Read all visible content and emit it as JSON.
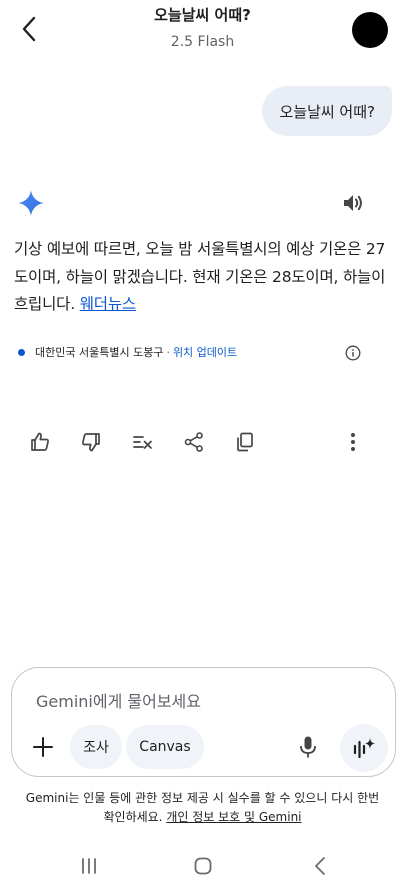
{
  "header": {
    "title": "오늘날씨 어때?",
    "model": "2.5 Flash"
  },
  "conversation": {
    "user_message": "오늘날씨 어때?",
    "answer_text": "기상 예보에 따르면, 오늘 밤 서울특별시의 예상 기온은 27도이며, 하늘이 맑겠습니다. 현재 기온은 28도이며, 하늘이 흐립니다.",
    "source_link": "웨더뉴스",
    "location": "대한민국 서울특별시 도봉구",
    "location_separator": "·",
    "update_location": "위치 업데이트"
  },
  "composer": {
    "placeholder": "Gemini에게 물어보세요",
    "chip_research": "조사",
    "chip_canvas": "Canvas"
  },
  "footer": {
    "disclaimer": "Gemini는 인물 등에 관한 정보 제공 시 실수를 할 수 있으니 다시 한번 확인하세요.",
    "privacy_link": "개인 정보 보호 및 Gemini"
  },
  "icons": {
    "back": "back-arrow-icon",
    "gemini": "gemini-sparkle-icon",
    "speaker": "speaker-icon",
    "info": "info-icon",
    "thumb_up": "thumb-up-icon",
    "thumb_down": "thumb-down-icon",
    "modify": "modify-response-icon",
    "share": "share-icon",
    "copy": "copy-icon",
    "more": "more-vert-icon",
    "plus": "plus-icon",
    "mic": "mic-icon",
    "live": "live-sparkle-icon"
  },
  "colors": {
    "link": "#0b57d0",
    "bubble": "#e9eef6",
    "chip": "#f0f4f9"
  }
}
